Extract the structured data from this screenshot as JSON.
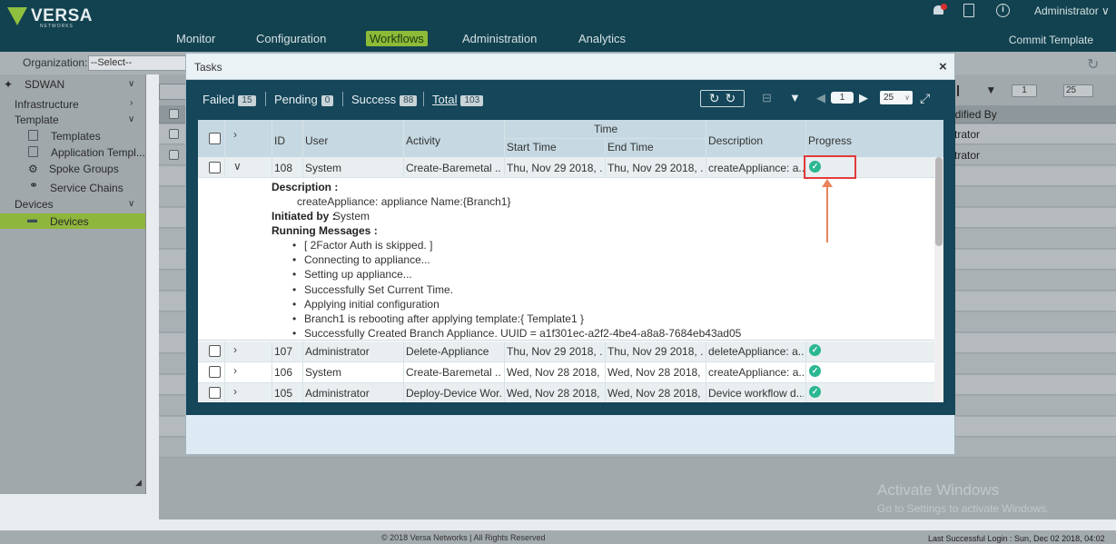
{
  "header": {
    "brand": "VERSA",
    "brand_sub": "NETWORKS",
    "nav": [
      "Monitor",
      "Configuration",
      "Workflows",
      "Administration",
      "Analytics"
    ],
    "active_nav": "Workflows",
    "commit_label": "Commit Template",
    "notification_count": "0",
    "user": "Administrator ∨"
  },
  "orgbar": {
    "label": "Organization:",
    "value": "--Select--"
  },
  "sidebar": {
    "root": "SDWAN",
    "infrastructure": "Infrastructure",
    "template": "Template",
    "templates": "Templates",
    "application_templates": "Application Templ...",
    "spoke_groups": "Spoke Groups",
    "service_chains": "Service Chains",
    "devices_group": "Devices",
    "devices": "Devices"
  },
  "background_table": {
    "col_header": "odified By",
    "rows": [
      "strator",
      "strator"
    ],
    "page": "1",
    "page_size": "25"
  },
  "modal": {
    "title": "Tasks",
    "close": "×",
    "stats": {
      "failed_label": "Failed",
      "failed_count": "15",
      "pending_label": "Pending",
      "pending_count": "0",
      "success_label": "Success",
      "success_count": "88",
      "total_label": "Total",
      "total_count": "103"
    },
    "page": "1",
    "page_size": "25",
    "columns": {
      "id": "ID",
      "user": "User",
      "activity": "Activity",
      "time": "Time",
      "start_time": "Start Time",
      "end_time": "End Time",
      "description": "Description",
      "progress": "Progress"
    },
    "expanded_row": {
      "id": "108",
      "user": "System",
      "activity": "Create-Baremetal ...",
      "start": "Thu, Nov 29 2018, ...",
      "end": "Thu, Nov 29 2018, ...",
      "description": "createAppliance: a...",
      "detail": {
        "description_label": "Description :",
        "description_text": "createAppliance: appliance Name:{Branch1}",
        "initiated_label": "Initiated by :",
        "initiated_value": "System",
        "messages_label": "Running Messages :",
        "messages": [
          "[ 2Factor Auth is skipped. ]",
          "Connecting to appliance...",
          "Setting up appliance...",
          "Successfully Set Current Time.",
          "Applying initial configuration",
          "Branch1 is rebooting after applying template:{ Template1 }",
          "Successfully Created Branch Appliance. UUID = a1f301ec-a2f2-4be4-a8a8-7684eb43ad05"
        ]
      }
    },
    "rows": [
      {
        "id": "107",
        "user": "Administrator",
        "activity": "Delete-Appliance",
        "start": "Thu, Nov 29 2018, ...",
        "end": "Thu, Nov 29 2018, ...",
        "description": "deleteAppliance: a..."
      },
      {
        "id": "106",
        "user": "System",
        "activity": "Create-Baremetal ...",
        "start": "Wed, Nov 28 2018, ...",
        "end": "Wed, Nov 28 2018, ...",
        "description": "createAppliance: a..."
      },
      {
        "id": "105",
        "user": "Administrator",
        "activity": "Deploy-Device Wor...",
        "start": "Wed, Nov 28 2018, ...",
        "end": "Wed, Nov 28 2018, ...",
        "description": "Device workflow d..."
      }
    ]
  },
  "footer": {
    "copyright": "© 2018 Versa Networks | All Rights Reserved",
    "last_login": "Last Successful Login : Sun, Dec 02 2018, 04:02"
  },
  "watermark": {
    "line1": "Activate Windows",
    "line2": "Go to Settings to activate Windows."
  },
  "colors": {
    "header_bg": "#12424f",
    "accent_green": "#8dbb38",
    "success_check": "#2bb792",
    "highlight_red": "#e23b3b",
    "annotation_arrow": "#e8835b"
  }
}
